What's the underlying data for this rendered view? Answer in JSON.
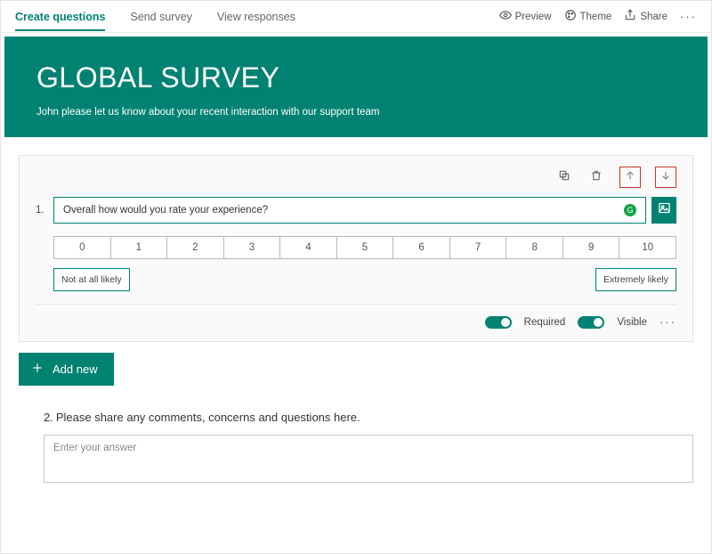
{
  "tabs": {
    "create": "Create questions",
    "send": "Send survey",
    "view": "View responses"
  },
  "topActions": {
    "preview": "Preview",
    "theme": "Theme",
    "share": "Share"
  },
  "hero": {
    "title": "GLOBAL SURVEY",
    "subtitle": "John please let us know about your recent interaction with our support team"
  },
  "question1": {
    "number": "1.",
    "text": "Overall how would you rate your experience?",
    "gBadge": "G",
    "scale": [
      "0",
      "1",
      "2",
      "3",
      "4",
      "5",
      "6",
      "7",
      "8",
      "9",
      "10"
    ],
    "lowLabel": "Not at all likely",
    "highLabel": "Extremely likely",
    "requiredLabel": "Required",
    "visibleLabel": "Visible"
  },
  "addNew": "Add new",
  "question2": {
    "number": "2.",
    "text": "Please share any comments, concerns and questions here.",
    "placeholder": "Enter your answer"
  }
}
